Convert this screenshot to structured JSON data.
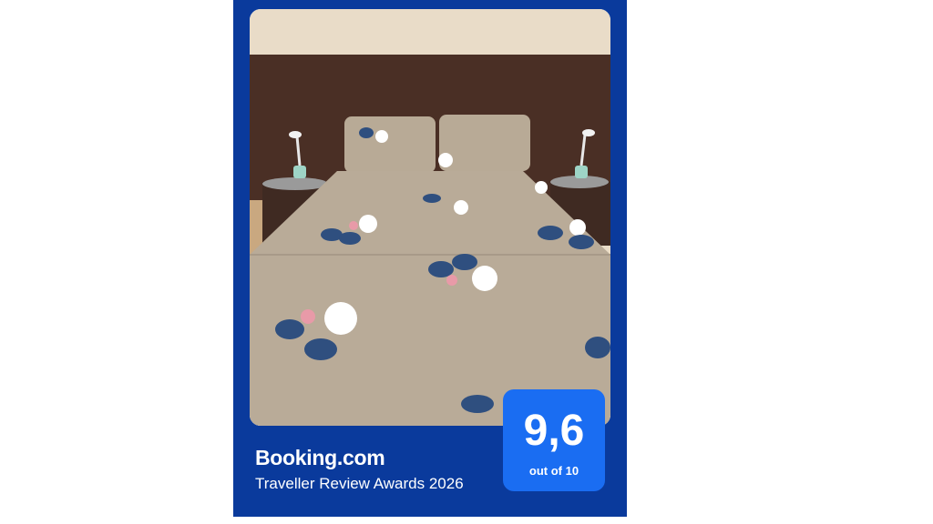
{
  "award": {
    "brand": "Booking.com",
    "title": "Traveller Review Awards 2026",
    "score": "9,6",
    "scale": "out of 10"
  },
  "colors": {
    "card_background": "#0a3a9c",
    "badge_background": "#1a6df2",
    "text": "#ffffff"
  },
  "photo": {
    "subject": "bed-with-floral-bedspread"
  }
}
